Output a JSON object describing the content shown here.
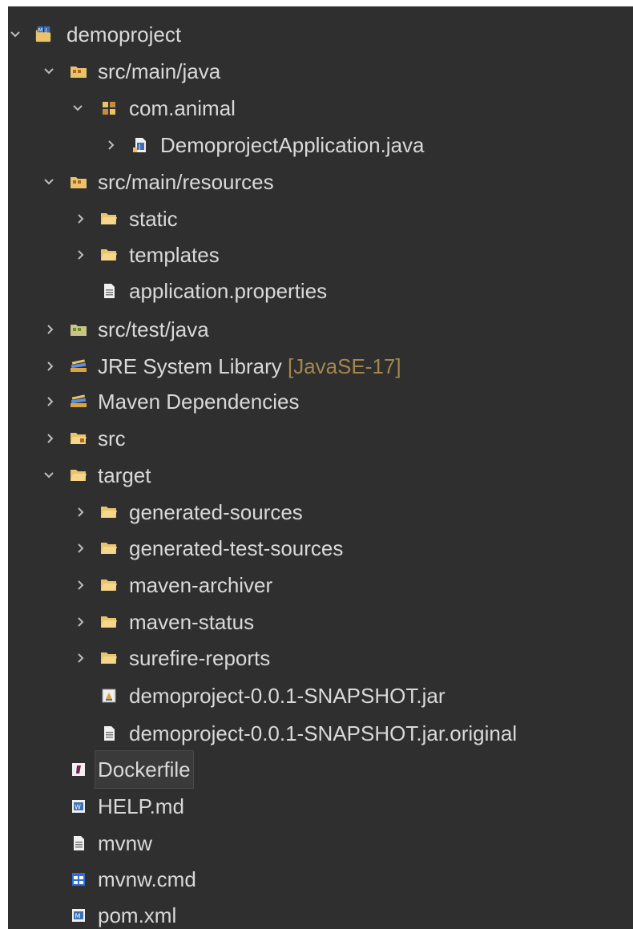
{
  "tree": {
    "root": {
      "label": "demoproject",
      "icon": "java-project-icon",
      "state": "expanded"
    },
    "items": [
      {
        "key": "src_main_java",
        "label": "src/main/java",
        "icon": "source-folder-icon",
        "state": "expanded"
      },
      {
        "key": "com_animal",
        "label": "com.animal",
        "icon": "package-icon",
        "state": "expanded"
      },
      {
        "key": "demo_app",
        "label": "DemoprojectApplication.java",
        "icon": "java-file-icon",
        "state": "collapsed"
      },
      {
        "key": "src_main_resources",
        "label": "src/main/resources",
        "icon": "source-folder-icon",
        "state": "expanded"
      },
      {
        "key": "static",
        "label": "static",
        "icon": "folder-icon",
        "state": "collapsed"
      },
      {
        "key": "templates",
        "label": "templates",
        "icon": "folder-icon",
        "state": "collapsed"
      },
      {
        "key": "app_props",
        "label": "application.properties",
        "icon": "file-icon",
        "state": "leaf"
      },
      {
        "key": "src_test_java",
        "label": "src/test/java",
        "icon": "test-source-folder-icon",
        "state": "collapsed"
      },
      {
        "key": "jre",
        "label": "JRE System Library",
        "decoration": "[JavaSE-17]",
        "icon": "library-icon",
        "state": "collapsed"
      },
      {
        "key": "maven_deps",
        "label": "Maven Dependencies",
        "icon": "library-icon",
        "state": "collapsed"
      },
      {
        "key": "src",
        "label": "src",
        "icon": "folder-icon",
        "state": "collapsed"
      },
      {
        "key": "target",
        "label": "target",
        "icon": "folder-icon",
        "state": "expanded"
      },
      {
        "key": "gen_sources",
        "label": "generated-sources",
        "icon": "folder-icon",
        "state": "collapsed"
      },
      {
        "key": "gen_test_sources",
        "label": "generated-test-sources",
        "icon": "folder-icon",
        "state": "collapsed"
      },
      {
        "key": "maven_archiver",
        "label": "maven-archiver",
        "icon": "folder-icon",
        "state": "collapsed"
      },
      {
        "key": "maven_status",
        "label": "maven-status",
        "icon": "folder-icon",
        "state": "collapsed"
      },
      {
        "key": "surefire",
        "label": "surefire-reports",
        "icon": "folder-icon",
        "state": "collapsed"
      },
      {
        "key": "jar",
        "label": "demoproject-0.0.1-SNAPSHOT.jar",
        "icon": "jar-icon",
        "state": "leaf"
      },
      {
        "key": "jar_original",
        "label": "demoproject-0.0.1-SNAPSHOT.jar.original",
        "icon": "file-icon",
        "state": "leaf"
      },
      {
        "key": "dockerfile",
        "label": "Dockerfile",
        "icon": "dockerfile-icon",
        "state": "leaf",
        "selected": true
      },
      {
        "key": "help_md",
        "label": "HELP.md",
        "icon": "markdown-file-icon",
        "state": "leaf"
      },
      {
        "key": "mvnw",
        "label": "mvnw",
        "icon": "file-icon",
        "state": "leaf"
      },
      {
        "key": "mvnw_cmd",
        "label": "mvnw.cmd",
        "icon": "cmd-file-icon",
        "state": "leaf"
      },
      {
        "key": "pom",
        "label": "pom.xml",
        "icon": "maven-pom-icon",
        "state": "leaf"
      }
    ]
  },
  "colors": {
    "background": "#2f2f2f",
    "text": "#d9d9d9",
    "decoration": "#a3864e",
    "folder": "#e9c46a",
    "arrow": "#bdbdbd"
  }
}
